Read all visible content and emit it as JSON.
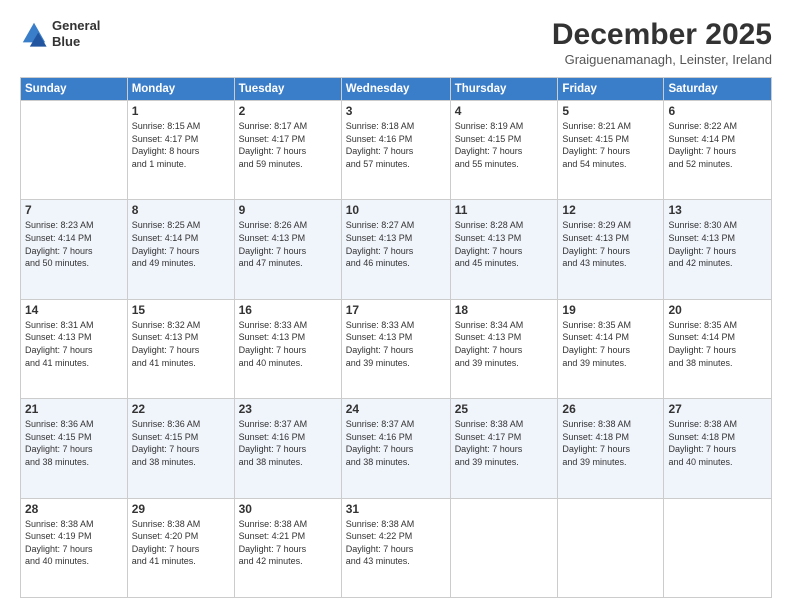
{
  "header": {
    "logo_line1": "General",
    "logo_line2": "Blue",
    "title": "December 2025",
    "subtitle": "Graiguenamanagh, Leinster, Ireland"
  },
  "columns": [
    "Sunday",
    "Monday",
    "Tuesday",
    "Wednesday",
    "Thursday",
    "Friday",
    "Saturday"
  ],
  "weeks": [
    [
      {
        "day": "",
        "info": ""
      },
      {
        "day": "1",
        "info": "Sunrise: 8:15 AM\nSunset: 4:17 PM\nDaylight: 8 hours\nand 1 minute."
      },
      {
        "day": "2",
        "info": "Sunrise: 8:17 AM\nSunset: 4:17 PM\nDaylight: 7 hours\nand 59 minutes."
      },
      {
        "day": "3",
        "info": "Sunrise: 8:18 AM\nSunset: 4:16 PM\nDaylight: 7 hours\nand 57 minutes."
      },
      {
        "day": "4",
        "info": "Sunrise: 8:19 AM\nSunset: 4:15 PM\nDaylight: 7 hours\nand 55 minutes."
      },
      {
        "day": "5",
        "info": "Sunrise: 8:21 AM\nSunset: 4:15 PM\nDaylight: 7 hours\nand 54 minutes."
      },
      {
        "day": "6",
        "info": "Sunrise: 8:22 AM\nSunset: 4:14 PM\nDaylight: 7 hours\nand 52 minutes."
      }
    ],
    [
      {
        "day": "7",
        "info": "Sunrise: 8:23 AM\nSunset: 4:14 PM\nDaylight: 7 hours\nand 50 minutes."
      },
      {
        "day": "8",
        "info": "Sunrise: 8:25 AM\nSunset: 4:14 PM\nDaylight: 7 hours\nand 49 minutes."
      },
      {
        "day": "9",
        "info": "Sunrise: 8:26 AM\nSunset: 4:13 PM\nDaylight: 7 hours\nand 47 minutes."
      },
      {
        "day": "10",
        "info": "Sunrise: 8:27 AM\nSunset: 4:13 PM\nDaylight: 7 hours\nand 46 minutes."
      },
      {
        "day": "11",
        "info": "Sunrise: 8:28 AM\nSunset: 4:13 PM\nDaylight: 7 hours\nand 45 minutes."
      },
      {
        "day": "12",
        "info": "Sunrise: 8:29 AM\nSunset: 4:13 PM\nDaylight: 7 hours\nand 43 minutes."
      },
      {
        "day": "13",
        "info": "Sunrise: 8:30 AM\nSunset: 4:13 PM\nDaylight: 7 hours\nand 42 minutes."
      }
    ],
    [
      {
        "day": "14",
        "info": "Sunrise: 8:31 AM\nSunset: 4:13 PM\nDaylight: 7 hours\nand 41 minutes."
      },
      {
        "day": "15",
        "info": "Sunrise: 8:32 AM\nSunset: 4:13 PM\nDaylight: 7 hours\nand 41 minutes."
      },
      {
        "day": "16",
        "info": "Sunrise: 8:33 AM\nSunset: 4:13 PM\nDaylight: 7 hours\nand 40 minutes."
      },
      {
        "day": "17",
        "info": "Sunrise: 8:33 AM\nSunset: 4:13 PM\nDaylight: 7 hours\nand 39 minutes."
      },
      {
        "day": "18",
        "info": "Sunrise: 8:34 AM\nSunset: 4:13 PM\nDaylight: 7 hours\nand 39 minutes."
      },
      {
        "day": "19",
        "info": "Sunrise: 8:35 AM\nSunset: 4:14 PM\nDaylight: 7 hours\nand 39 minutes."
      },
      {
        "day": "20",
        "info": "Sunrise: 8:35 AM\nSunset: 4:14 PM\nDaylight: 7 hours\nand 38 minutes."
      }
    ],
    [
      {
        "day": "21",
        "info": "Sunrise: 8:36 AM\nSunset: 4:15 PM\nDaylight: 7 hours\nand 38 minutes."
      },
      {
        "day": "22",
        "info": "Sunrise: 8:36 AM\nSunset: 4:15 PM\nDaylight: 7 hours\nand 38 minutes."
      },
      {
        "day": "23",
        "info": "Sunrise: 8:37 AM\nSunset: 4:16 PM\nDaylight: 7 hours\nand 38 minutes."
      },
      {
        "day": "24",
        "info": "Sunrise: 8:37 AM\nSunset: 4:16 PM\nDaylight: 7 hours\nand 38 minutes."
      },
      {
        "day": "25",
        "info": "Sunrise: 8:38 AM\nSunset: 4:17 PM\nDaylight: 7 hours\nand 39 minutes."
      },
      {
        "day": "26",
        "info": "Sunrise: 8:38 AM\nSunset: 4:18 PM\nDaylight: 7 hours\nand 39 minutes."
      },
      {
        "day": "27",
        "info": "Sunrise: 8:38 AM\nSunset: 4:18 PM\nDaylight: 7 hours\nand 40 minutes."
      }
    ],
    [
      {
        "day": "28",
        "info": "Sunrise: 8:38 AM\nSunset: 4:19 PM\nDaylight: 7 hours\nand 40 minutes."
      },
      {
        "day": "29",
        "info": "Sunrise: 8:38 AM\nSunset: 4:20 PM\nDaylight: 7 hours\nand 41 minutes."
      },
      {
        "day": "30",
        "info": "Sunrise: 8:38 AM\nSunset: 4:21 PM\nDaylight: 7 hours\nand 42 minutes."
      },
      {
        "day": "31",
        "info": "Sunrise: 8:38 AM\nSunset: 4:22 PM\nDaylight: 7 hours\nand 43 minutes."
      },
      {
        "day": "",
        "info": ""
      },
      {
        "day": "",
        "info": ""
      },
      {
        "day": "",
        "info": ""
      }
    ]
  ]
}
